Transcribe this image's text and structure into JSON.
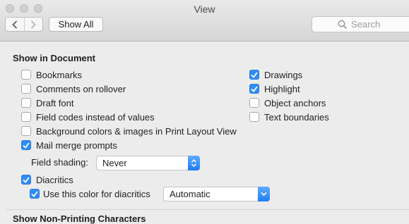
{
  "window": {
    "title": "View"
  },
  "toolbar": {
    "show_all_label": "Show All",
    "search_placeholder": "Search"
  },
  "show_in_document": {
    "title": "Show in Document",
    "left_options": [
      {
        "label": "Bookmarks",
        "checked": false
      },
      {
        "label": "Comments on rollover",
        "checked": false
      },
      {
        "label": "Draft font",
        "checked": false
      },
      {
        "label": "Field codes instead of values",
        "checked": false
      },
      {
        "label": "Background colors & images in Print Layout View",
        "checked": false
      },
      {
        "label": "Mail merge prompts",
        "checked": true
      }
    ],
    "right_options": [
      {
        "label": "Drawings",
        "checked": true
      },
      {
        "label": "Highlight",
        "checked": true
      },
      {
        "label": "Object anchors",
        "checked": false
      },
      {
        "label": "Text boundaries",
        "checked": false
      }
    ],
    "field_shading": {
      "label": "Field shading:",
      "value": "Never"
    },
    "diacritics": {
      "label": "Diacritics",
      "checked": true
    },
    "diacritics_color": {
      "label": "Use this color for diacritics",
      "checked": true,
      "value": "Automatic"
    }
  },
  "next_section": {
    "title": "Show Non-Printing Characters"
  },
  "colors": {
    "accent": "#2f8cf6"
  }
}
